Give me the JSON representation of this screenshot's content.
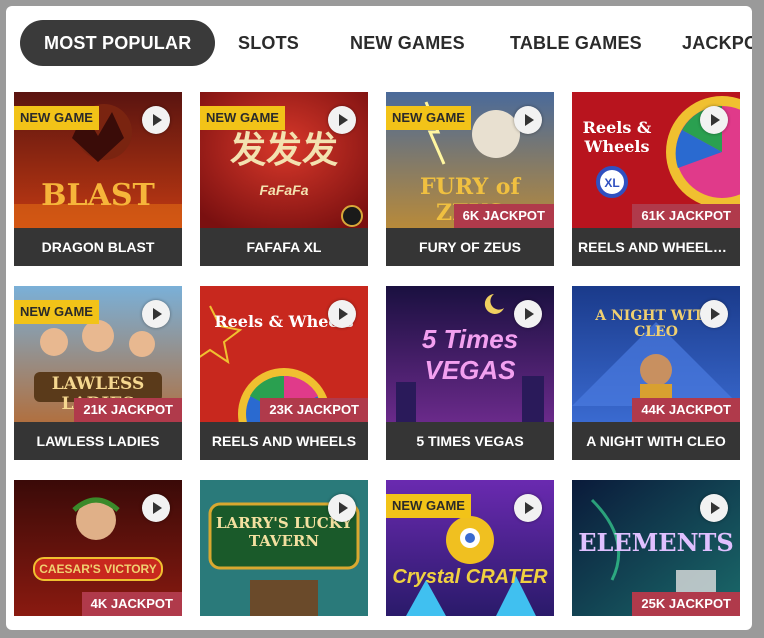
{
  "nav": {
    "tabs": [
      {
        "label": "MOST POPULAR",
        "active": true
      },
      {
        "label": "SLOTS",
        "active": false
      },
      {
        "label": "NEW GAMES",
        "active": false
      },
      {
        "label": "TABLE GAMES",
        "active": false
      },
      {
        "label": "JACKPOTS",
        "active": false
      }
    ]
  },
  "badges": {
    "new_game": "NEW GAME"
  },
  "games": [
    {
      "title": "DRAGON BLAST",
      "new": true,
      "jackpot": "",
      "art_text": "BLAST",
      "icon": "dragon-art"
    },
    {
      "title": "FAFAFA XL",
      "new": true,
      "jackpot": "",
      "art_text": "FaFaFa",
      "icon": "fafafa-art"
    },
    {
      "title": "FURY OF ZEUS",
      "new": true,
      "jackpot": "6K JACKPOT",
      "art_text": "FURY of ZEUS",
      "icon": "zeus-art"
    },
    {
      "title": "REELS AND WHEELS ...",
      "new": false,
      "jackpot": "61K JACKPOT",
      "art_text": "Reels & Wheels",
      "icon": "wheel-art"
    },
    {
      "title": "LAWLESS LADIES",
      "new": true,
      "jackpot": "21K JACKPOT",
      "art_text": "LAWLESS LADIES",
      "icon": "ladies-art"
    },
    {
      "title": "REELS AND WHEELS",
      "new": false,
      "jackpot": "23K JACKPOT",
      "art_text": "Reels & Wheels",
      "icon": "wheel-art"
    },
    {
      "title": "5 TIMES VEGAS",
      "new": false,
      "jackpot": "",
      "art_text": "5 Times VEGAS",
      "icon": "vegas-art"
    },
    {
      "title": "A NIGHT WITH CLEO",
      "new": false,
      "jackpot": "44K JACKPOT",
      "art_text": "A NIGHT WITH CLEO",
      "icon": "pyramid-art"
    },
    {
      "title": "",
      "new": false,
      "jackpot": "4K JACKPOT",
      "art_text": "CAESAR'S VICTORY",
      "icon": "caesar-art"
    },
    {
      "title": "",
      "new": false,
      "jackpot": "",
      "art_text": "LARRY'S LUCKY TAVERN",
      "icon": "tavern-art"
    },
    {
      "title": "",
      "new": true,
      "jackpot": "",
      "art_text": "Crystal CRATER",
      "icon": "crystal-art"
    },
    {
      "title": "",
      "new": false,
      "jackpot": "25K JACKPOT",
      "art_text": "ELEMENTS",
      "icon": "elements-art"
    }
  ],
  "colors": {
    "active_tab_bg": "#3a3a3a",
    "new_badge_bg": "#f2c318",
    "jackpot_bg": "#b03a4b",
    "title_bar_bg": "#353535"
  }
}
